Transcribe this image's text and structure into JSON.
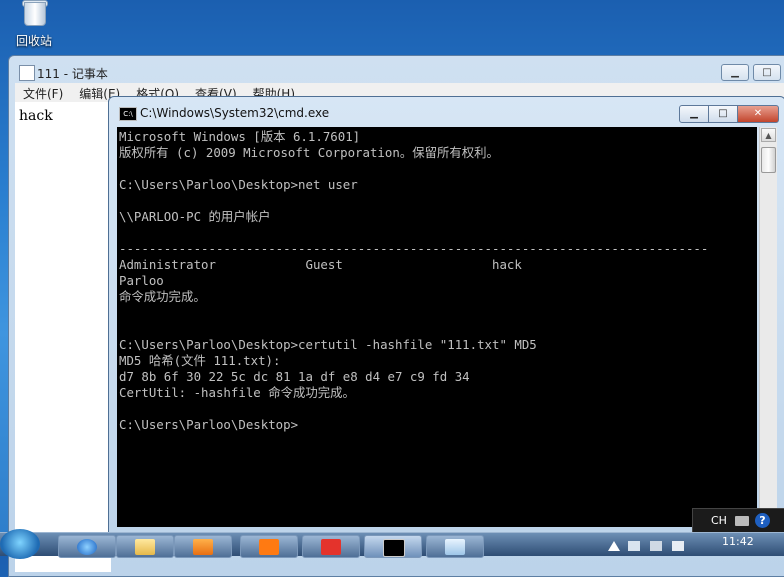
{
  "desktop": {
    "recycle_bin_label": "回收站"
  },
  "notepad": {
    "title": "111 - 记事本",
    "menu": [
      "文件(F)",
      "编辑(E)",
      "格式(O)",
      "查看(V)",
      "帮助(H)"
    ],
    "content": "hack"
  },
  "cmd": {
    "title": "C:\\Windows\\System32\\cmd.exe",
    "icon_label": "C:\\",
    "lines": [
      "Microsoft Windows [版本 6.1.7601]",
      "版权所有 (c) 2009 Microsoft Corporation。保留所有权利。",
      "",
      "C:\\Users\\Parloo\\Desktop>net user",
      "",
      "\\\\PARLOO-PC 的用户帐户",
      "",
      "-------------------------------------------------------------------------------",
      "Administrator            Guest                    hack",
      "Parloo",
      "命令成功完成。",
      "",
      "",
      "C:\\Users\\Parloo\\Desktop>certutil -hashfile \"111.txt\" MD5",
      "MD5 哈希(文件 111.txt):",
      "d7 8b 6f 30 22 5c dc 81 1a df e8 d4 e7 c9 fd 34",
      "CertUtil: -hashfile 命令成功完成。",
      "",
      "C:\\Users\\Parloo\\Desktop>"
    ]
  },
  "taskbar": {
    "language": "CH",
    "help": "?",
    "clock": "11:42"
  },
  "colors": {
    "console_bg": "#000000",
    "console_fg": "#c0c0c0",
    "desktop_blue": "#2a7fd0"
  }
}
